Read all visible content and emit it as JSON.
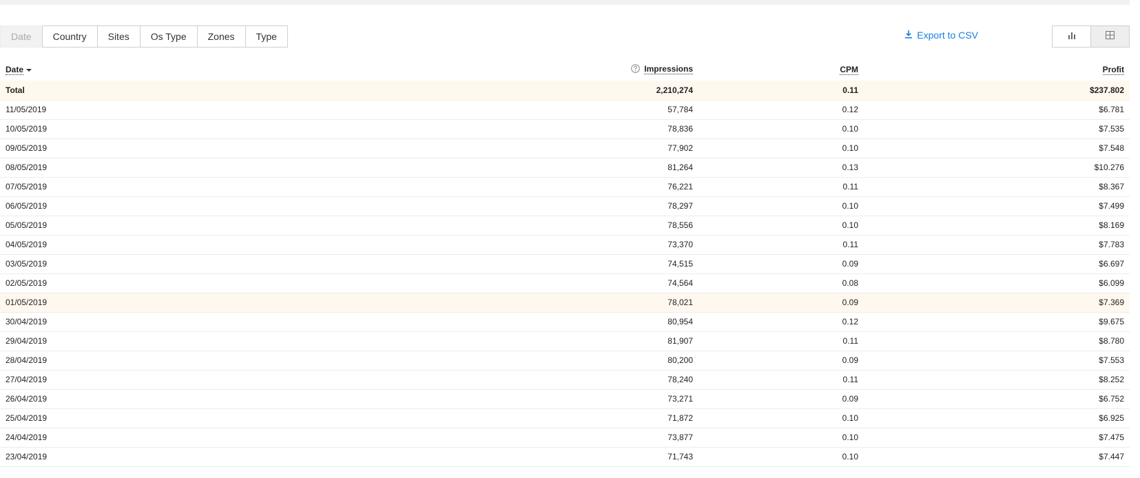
{
  "groupby": {
    "buttons": [
      "Date",
      "Country",
      "Sites",
      "Os Type",
      "Zones",
      "Type"
    ],
    "active_index": 0
  },
  "toolbar": {
    "export_label": "Export to CSV",
    "view_chart_icon": "bar-chart-icon",
    "view_table_icon": "grid-icon",
    "active_view": "table",
    "accent_color": "#1a7fe0"
  },
  "table": {
    "headers": {
      "date": "Date",
      "impressions": "Impressions",
      "cpm": "CPM",
      "profit": "Profit"
    },
    "sort": {
      "column": "date",
      "direction": "desc"
    },
    "total": {
      "label": "Total",
      "impressions": "2,210,274",
      "cpm": "0.11",
      "profit": "$237.802"
    },
    "rows": [
      {
        "date": "11/05/2019",
        "impressions": "57,784",
        "cpm": "0.12",
        "profit": "$6.781"
      },
      {
        "date": "10/05/2019",
        "impressions": "78,836",
        "cpm": "0.10",
        "profit": "$7.535"
      },
      {
        "date": "09/05/2019",
        "impressions": "77,902",
        "cpm": "0.10",
        "profit": "$7.548"
      },
      {
        "date": "08/05/2019",
        "impressions": "81,264",
        "cpm": "0.13",
        "profit": "$10.276"
      },
      {
        "date": "07/05/2019",
        "impressions": "76,221",
        "cpm": "0.11",
        "profit": "$8.367"
      },
      {
        "date": "06/05/2019",
        "impressions": "78,297",
        "cpm": "0.10",
        "profit": "$7.499"
      },
      {
        "date": "05/05/2019",
        "impressions": "78,556",
        "cpm": "0.10",
        "profit": "$8.169"
      },
      {
        "date": "04/05/2019",
        "impressions": "73,370",
        "cpm": "0.11",
        "profit": "$7.783"
      },
      {
        "date": "03/05/2019",
        "impressions": "74,515",
        "cpm": "0.09",
        "profit": "$6.697"
      },
      {
        "date": "02/05/2019",
        "impressions": "74,564",
        "cpm": "0.08",
        "profit": "$6.099"
      },
      {
        "date": "01/05/2019",
        "impressions": "78,021",
        "cpm": "0.09",
        "profit": "$7.369"
      },
      {
        "date": "30/04/2019",
        "impressions": "80,954",
        "cpm": "0.12",
        "profit": "$9.675"
      },
      {
        "date": "29/04/2019",
        "impressions": "81,907",
        "cpm": "0.11",
        "profit": "$8.780"
      },
      {
        "date": "28/04/2019",
        "impressions": "80,200",
        "cpm": "0.09",
        "profit": "$7.553"
      },
      {
        "date": "27/04/2019",
        "impressions": "78,240",
        "cpm": "0.11",
        "profit": "$8.252"
      },
      {
        "date": "26/04/2019",
        "impressions": "73,271",
        "cpm": "0.09",
        "profit": "$6.752"
      },
      {
        "date": "25/04/2019",
        "impressions": "71,872",
        "cpm": "0.10",
        "profit": "$6.925"
      },
      {
        "date": "24/04/2019",
        "impressions": "73,877",
        "cpm": "0.10",
        "profit": "$7.475"
      },
      {
        "date": "23/04/2019",
        "impressions": "71,743",
        "cpm": "0.10",
        "profit": "$7.447"
      }
    ]
  }
}
